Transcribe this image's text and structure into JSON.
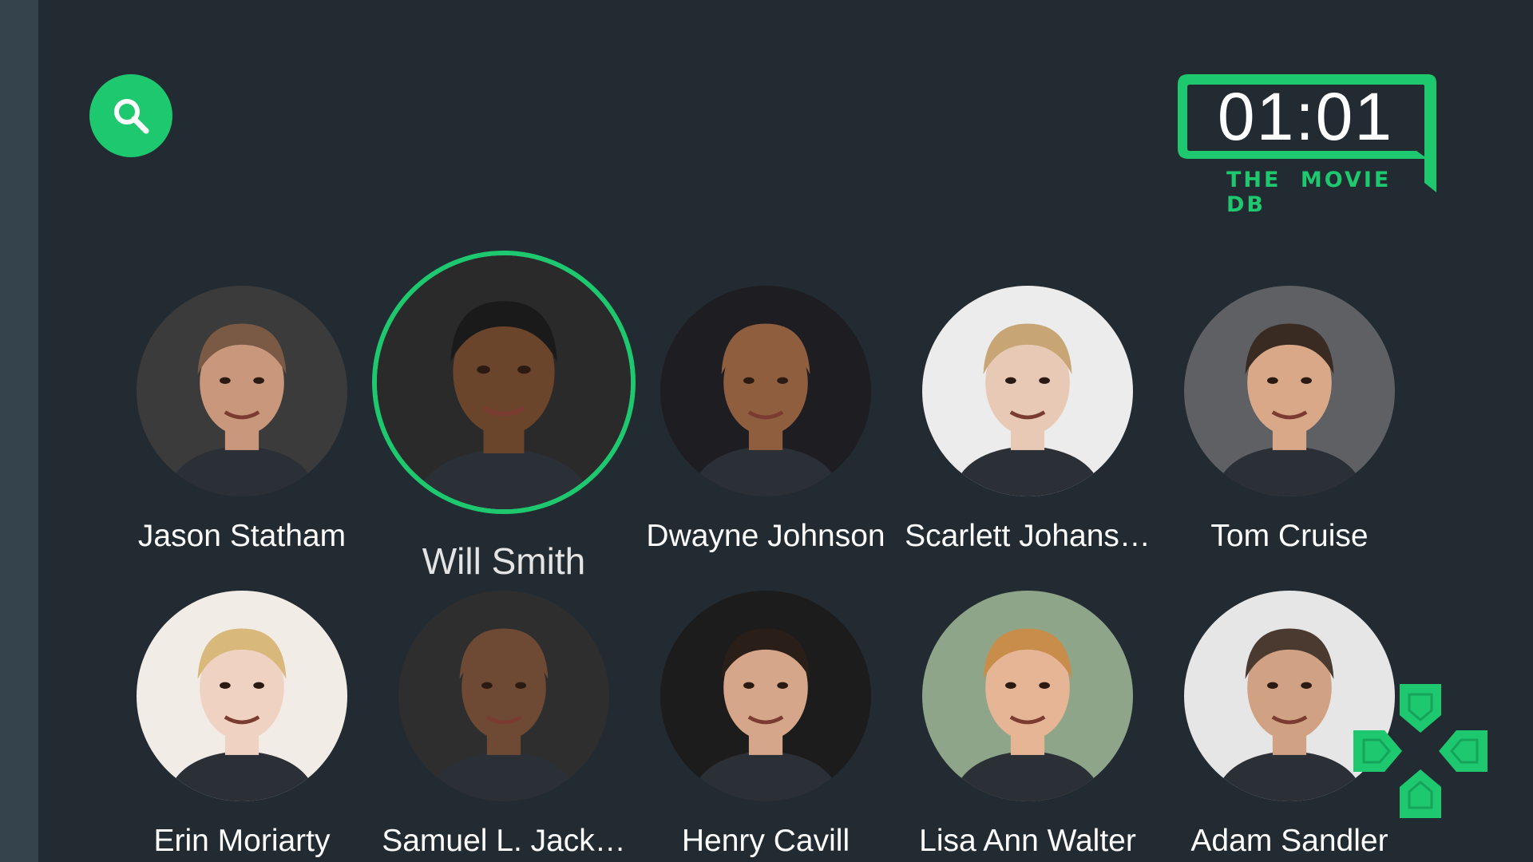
{
  "app": {
    "clock": "01:01",
    "brand": "THE MOVIE DB",
    "accent_color": "#1ec86f",
    "background_color": "#222b31"
  },
  "search": {
    "icon": "search-icon"
  },
  "people": [
    {
      "name": "Jason Statham",
      "bg": "#3b3b3b",
      "skin": "#c9977c",
      "hair": "#7a5a44",
      "focused": false
    },
    {
      "name": "Will Smith",
      "bg": "#2a2a2a",
      "skin": "#6b442c",
      "hair": "#1a1a1a",
      "focused": true
    },
    {
      "name": "Dwayne Johnson",
      "bg": "#1d1d22",
      "skin": "#8e5e3f",
      "hair": "#8e5e3f",
      "focused": false
    },
    {
      "name": "Scarlett Johans…",
      "bg": "#ececec",
      "skin": "#e8c9b6",
      "hair": "#c8a574",
      "focused": false
    },
    {
      "name": "Tom Cruise",
      "bg": "#5e6064",
      "skin": "#d9a888",
      "hair": "#3a2b22",
      "focused": false
    },
    {
      "name": "Erin Moriarty",
      "bg": "#f1ece6",
      "skin": "#f0d2c2",
      "hair": "#d9b87c",
      "focused": false
    },
    {
      "name": "Samuel L. Jack…",
      "bg": "#2e2e2e",
      "skin": "#6e4a34",
      "hair": "#6e4a34",
      "focused": false
    },
    {
      "name": "Henry Cavill",
      "bg": "#1c1c1c",
      "skin": "#d6a68a",
      "hair": "#2a1e18",
      "focused": false
    },
    {
      "name": "Lisa Ann Walter",
      "bg": "#8fa58a",
      "skin": "#e6b596",
      "hair": "#c88d4a",
      "focused": false
    },
    {
      "name": "Adam Sandler",
      "bg": "#e6e6e6",
      "skin": "#d0a183",
      "hair": "#4a3a30",
      "focused": false
    }
  ],
  "controller": {
    "icon": "dpad-icon"
  }
}
